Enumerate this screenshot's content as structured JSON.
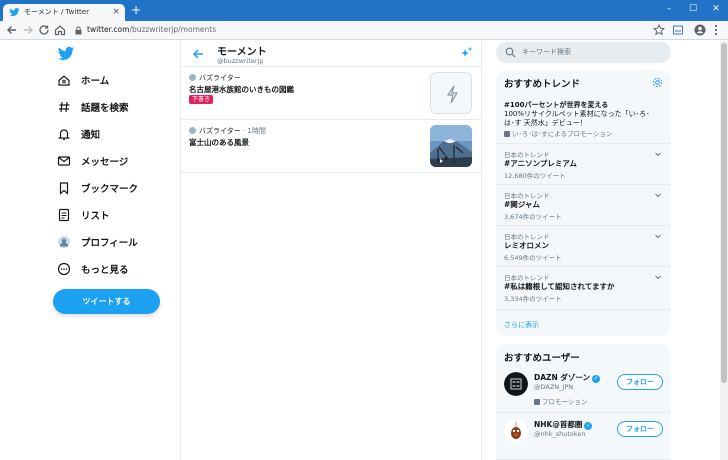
{
  "browser": {
    "tab_title": "モーメント / Twitter",
    "tab_close": "×",
    "new_tab": "+",
    "url_host": "twitter.com",
    "url_path": "/buzzwriterjp/moments",
    "window_minimize": "–",
    "window_maximize": "☐",
    "window_close": "✕"
  },
  "nav": {
    "items": [
      {
        "label": "ホーム"
      },
      {
        "label": "話題を検索"
      },
      {
        "label": "通知"
      },
      {
        "label": "メッセージ"
      },
      {
        "label": "ブックマーク"
      },
      {
        "label": "リスト"
      },
      {
        "label": "プロフィール"
      },
      {
        "label": "もっと見る"
      }
    ],
    "tweet_button": "ツイートする"
  },
  "center": {
    "title": "モーメント",
    "handle": "@buzzwriterjp",
    "moments": [
      {
        "author": "バズライター",
        "time": "",
        "title": "名古屋港水族館のいきもの図鑑",
        "badge": "下書き"
      },
      {
        "author": "バズライター",
        "time": "· 1時間",
        "title": "富士山のある風景",
        "badge": ""
      }
    ]
  },
  "right": {
    "search_placeholder": "キーワード検索",
    "trends_heading": "おすすめトレンド",
    "trends": [
      {
        "context": "",
        "name": "#100パーセントが世界を変える",
        "desc": "100%リサイクルペット素材になった「い･ろ･",
        "desc2": "は･す 天然水」デビュー！",
        "promo": "い･ろ･は･すによるプロモーション",
        "count": ""
      },
      {
        "context": "日本のトレンド",
        "name": "#アニソンプレミアム",
        "count": "12,680件のツイート"
      },
      {
        "context": "日本のトレンド",
        "name": "#関ジャム",
        "count": "3,674件のツイート"
      },
      {
        "context": "日本のトレンド",
        "name": "レミオロメン",
        "count": "6,549件のツイート"
      },
      {
        "context": "日本のトレンド",
        "name": "#私は籍根して認知されてますか",
        "count": "3,334件のツイート"
      }
    ],
    "show_more": "さらに表示",
    "users_heading": "おすすめユーザー",
    "users": [
      {
        "name": "DAZN ダゾーン",
        "handle": "@DAZN_JPN",
        "promo": "プロモーション",
        "follow": "フォロー",
        "verified": "✓"
      },
      {
        "name": "NHK@首都圏",
        "handle": "@nhk_shutoken",
        "promo": "",
        "follow": "フォロー",
        "verified": "✓"
      }
    ]
  },
  "colors": {
    "accent": "#1da1f2",
    "draft_badge": "#e0245e",
    "titlebar": "#2173c7"
  }
}
